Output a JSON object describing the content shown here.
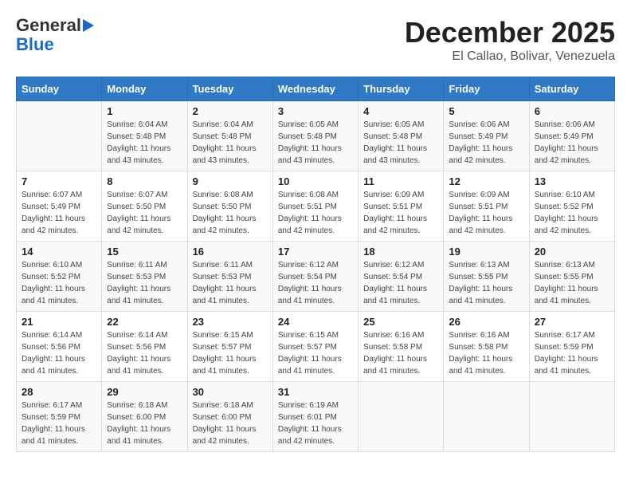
{
  "logo": {
    "line1": "General",
    "line2": "Blue"
  },
  "title": "December 2025",
  "subtitle": "El Callao, Bolivar, Venezuela",
  "headers": [
    "Sunday",
    "Monday",
    "Tuesday",
    "Wednesday",
    "Thursday",
    "Friday",
    "Saturday"
  ],
  "weeks": [
    [
      {
        "day": "",
        "info": ""
      },
      {
        "day": "1",
        "info": "Sunrise: 6:04 AM\nSunset: 5:48 PM\nDaylight: 11 hours\nand 43 minutes."
      },
      {
        "day": "2",
        "info": "Sunrise: 6:04 AM\nSunset: 5:48 PM\nDaylight: 11 hours\nand 43 minutes."
      },
      {
        "day": "3",
        "info": "Sunrise: 6:05 AM\nSunset: 5:48 PM\nDaylight: 11 hours\nand 43 minutes."
      },
      {
        "day": "4",
        "info": "Sunrise: 6:05 AM\nSunset: 5:48 PM\nDaylight: 11 hours\nand 43 minutes."
      },
      {
        "day": "5",
        "info": "Sunrise: 6:06 AM\nSunset: 5:49 PM\nDaylight: 11 hours\nand 42 minutes."
      },
      {
        "day": "6",
        "info": "Sunrise: 6:06 AM\nSunset: 5:49 PM\nDaylight: 11 hours\nand 42 minutes."
      }
    ],
    [
      {
        "day": "7",
        "info": "Sunrise: 6:07 AM\nSunset: 5:49 PM\nDaylight: 11 hours\nand 42 minutes."
      },
      {
        "day": "8",
        "info": "Sunrise: 6:07 AM\nSunset: 5:50 PM\nDaylight: 11 hours\nand 42 minutes."
      },
      {
        "day": "9",
        "info": "Sunrise: 6:08 AM\nSunset: 5:50 PM\nDaylight: 11 hours\nand 42 minutes."
      },
      {
        "day": "10",
        "info": "Sunrise: 6:08 AM\nSunset: 5:51 PM\nDaylight: 11 hours\nand 42 minutes."
      },
      {
        "day": "11",
        "info": "Sunrise: 6:09 AM\nSunset: 5:51 PM\nDaylight: 11 hours\nand 42 minutes."
      },
      {
        "day": "12",
        "info": "Sunrise: 6:09 AM\nSunset: 5:51 PM\nDaylight: 11 hours\nand 42 minutes."
      },
      {
        "day": "13",
        "info": "Sunrise: 6:10 AM\nSunset: 5:52 PM\nDaylight: 11 hours\nand 42 minutes."
      }
    ],
    [
      {
        "day": "14",
        "info": "Sunrise: 6:10 AM\nSunset: 5:52 PM\nDaylight: 11 hours\nand 41 minutes."
      },
      {
        "day": "15",
        "info": "Sunrise: 6:11 AM\nSunset: 5:53 PM\nDaylight: 11 hours\nand 41 minutes."
      },
      {
        "day": "16",
        "info": "Sunrise: 6:11 AM\nSunset: 5:53 PM\nDaylight: 11 hours\nand 41 minutes."
      },
      {
        "day": "17",
        "info": "Sunrise: 6:12 AM\nSunset: 5:54 PM\nDaylight: 11 hours\nand 41 minutes."
      },
      {
        "day": "18",
        "info": "Sunrise: 6:12 AM\nSunset: 5:54 PM\nDaylight: 11 hours\nand 41 minutes."
      },
      {
        "day": "19",
        "info": "Sunrise: 6:13 AM\nSunset: 5:55 PM\nDaylight: 11 hours\nand 41 minutes."
      },
      {
        "day": "20",
        "info": "Sunrise: 6:13 AM\nSunset: 5:55 PM\nDaylight: 11 hours\nand 41 minutes."
      }
    ],
    [
      {
        "day": "21",
        "info": "Sunrise: 6:14 AM\nSunset: 5:56 PM\nDaylight: 11 hours\nand 41 minutes."
      },
      {
        "day": "22",
        "info": "Sunrise: 6:14 AM\nSunset: 5:56 PM\nDaylight: 11 hours\nand 41 minutes."
      },
      {
        "day": "23",
        "info": "Sunrise: 6:15 AM\nSunset: 5:57 PM\nDaylight: 11 hours\nand 41 minutes."
      },
      {
        "day": "24",
        "info": "Sunrise: 6:15 AM\nSunset: 5:57 PM\nDaylight: 11 hours\nand 41 minutes."
      },
      {
        "day": "25",
        "info": "Sunrise: 6:16 AM\nSunset: 5:58 PM\nDaylight: 11 hours\nand 41 minutes."
      },
      {
        "day": "26",
        "info": "Sunrise: 6:16 AM\nSunset: 5:58 PM\nDaylight: 11 hours\nand 41 minutes."
      },
      {
        "day": "27",
        "info": "Sunrise: 6:17 AM\nSunset: 5:59 PM\nDaylight: 11 hours\nand 41 minutes."
      }
    ],
    [
      {
        "day": "28",
        "info": "Sunrise: 6:17 AM\nSunset: 5:59 PM\nDaylight: 11 hours\nand 41 minutes."
      },
      {
        "day": "29",
        "info": "Sunrise: 6:18 AM\nSunset: 6:00 PM\nDaylight: 11 hours\nand 41 minutes."
      },
      {
        "day": "30",
        "info": "Sunrise: 6:18 AM\nSunset: 6:00 PM\nDaylight: 11 hours\nand 42 minutes."
      },
      {
        "day": "31",
        "info": "Sunrise: 6:19 AM\nSunset: 6:01 PM\nDaylight: 11 hours\nand 42 minutes."
      },
      {
        "day": "",
        "info": ""
      },
      {
        "day": "",
        "info": ""
      },
      {
        "day": "",
        "info": ""
      }
    ]
  ]
}
